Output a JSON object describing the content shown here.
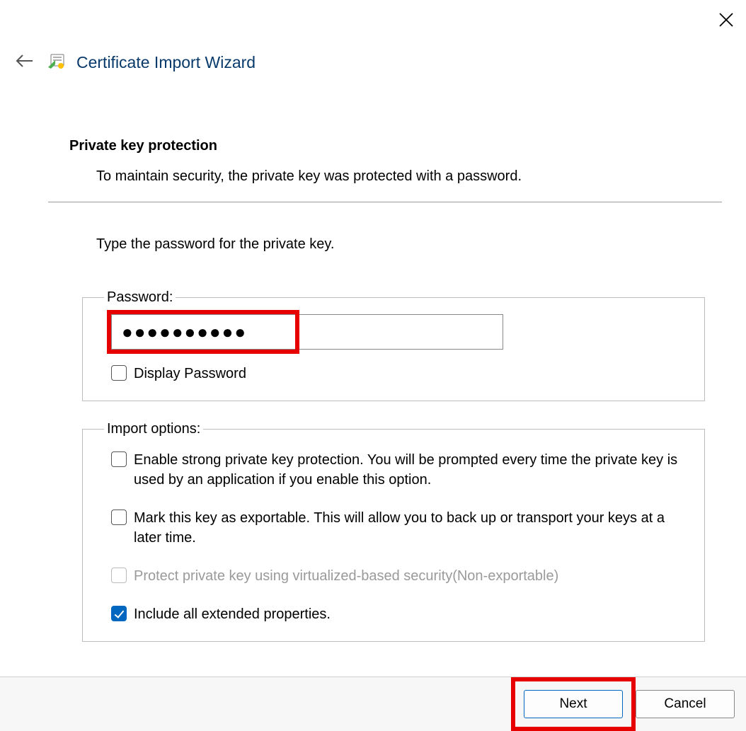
{
  "window": {
    "title": "Certificate Import Wizard"
  },
  "page": {
    "heading": "Private key protection",
    "description": "To maintain security, the private key was protected with a password.",
    "instruction": "Type the password for the private key."
  },
  "password_group": {
    "legend": "Password:",
    "value": "●●●●●●●●●●",
    "display_label": "Display Password",
    "display_checked": false
  },
  "options_group": {
    "legend": "Import options:",
    "items": [
      {
        "key": "strong",
        "label": "Enable strong private key protection. You will be prompted every time the private key is used by an application if you enable this option.",
        "checked": false,
        "disabled": false
      },
      {
        "key": "export",
        "label": "Mark this key as exportable. This will allow you to back up or transport your keys at a later time.",
        "checked": false,
        "disabled": false
      },
      {
        "key": "vbs",
        "label": "Protect private key using virtualized-based security(Non-exportable)",
        "checked": false,
        "disabled": true
      },
      {
        "key": "extprops",
        "label": "Include all extended properties.",
        "checked": true,
        "disabled": false
      }
    ]
  },
  "buttons": {
    "next": "Next",
    "cancel": "Cancel"
  }
}
